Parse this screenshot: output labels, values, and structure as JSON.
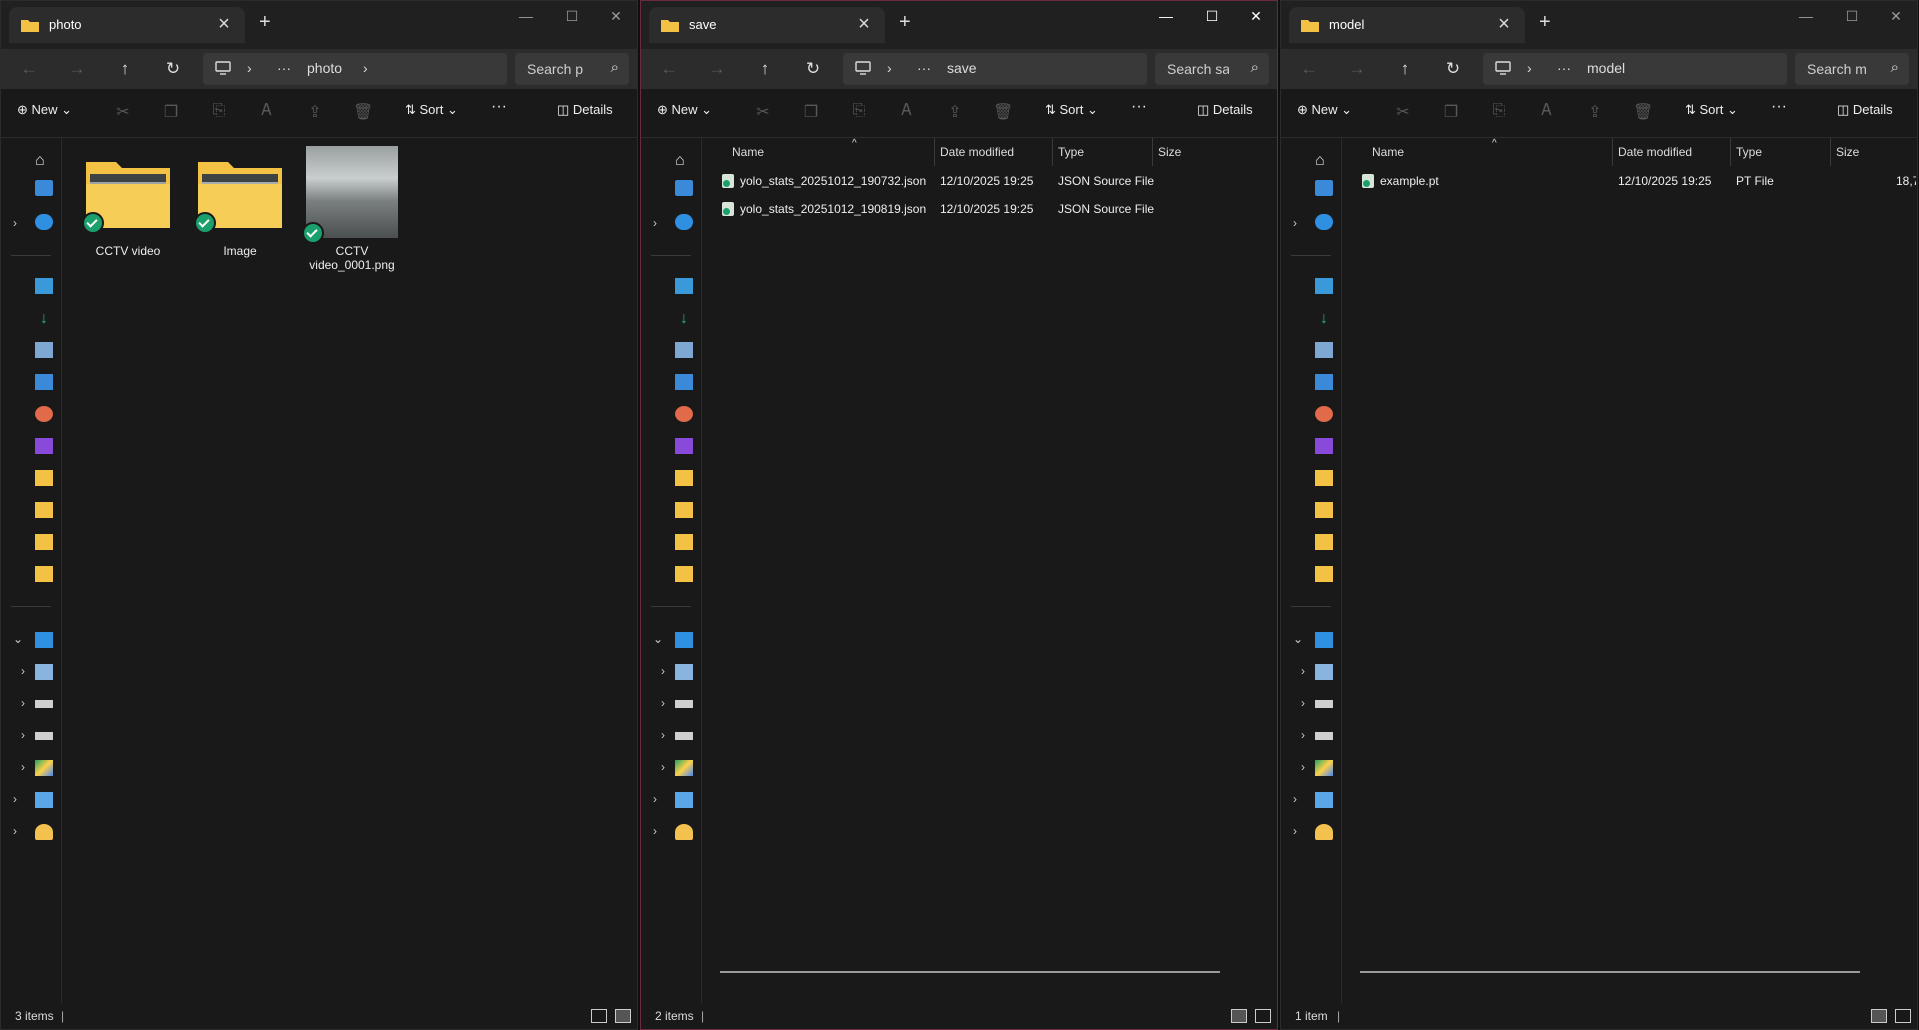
{
  "windows": [
    {
      "tab_title": "photo",
      "breadcrumb": [
        "photo"
      ],
      "search_placeholder": "Search p",
      "toolbar": {
        "new_label": "New",
        "sort_label": "Sort",
        "details_label": "Details"
      },
      "view": "icons",
      "items": [
        {
          "name": "CCTV video",
          "kind": "folder"
        },
        {
          "name": "Image",
          "kind": "folder"
        },
        {
          "name": "CCTV\nvideo_0001.png",
          "kind": "image"
        }
      ],
      "status": "3 items"
    },
    {
      "tab_title": "save",
      "breadcrumb": [
        "save"
      ],
      "search_placeholder": "Search sa",
      "toolbar": {
        "new_label": "New",
        "sort_label": "Sort",
        "details_label": "Details"
      },
      "view": "details",
      "columns": [
        "Name",
        "Date modified",
        "Type",
        "Size"
      ],
      "rows": [
        {
          "name": "yolo_stats_20251012_190732.json",
          "date": "12/10/2025 19:25",
          "type": "JSON Source File"
        },
        {
          "name": "yolo_stats_20251012_190819.json",
          "date": "12/10/2025 19:25",
          "type": "JSON Source File"
        }
      ],
      "status": "2 items",
      "active": true
    },
    {
      "tab_title": "model",
      "breadcrumb": [
        "model"
      ],
      "search_placeholder": "Search m",
      "toolbar": {
        "new_label": "New",
        "sort_label": "Sort",
        "details_label": "Details"
      },
      "view": "details",
      "columns": [
        "Name",
        "Date modified",
        "Type",
        "Size"
      ],
      "rows": [
        {
          "name": "example.pt",
          "date": "12/10/2025 19:25",
          "type": "PT File",
          "size": "18,7"
        }
      ],
      "status": "1 item"
    }
  ],
  "icons": {
    "ellipsis": "ellipsis-icon",
    "check": "sync-check-icon"
  },
  "colors": {
    "folder": "#f3c244",
    "accent_border": "#6b2a3e",
    "sync_badge": "#1aa06d"
  }
}
